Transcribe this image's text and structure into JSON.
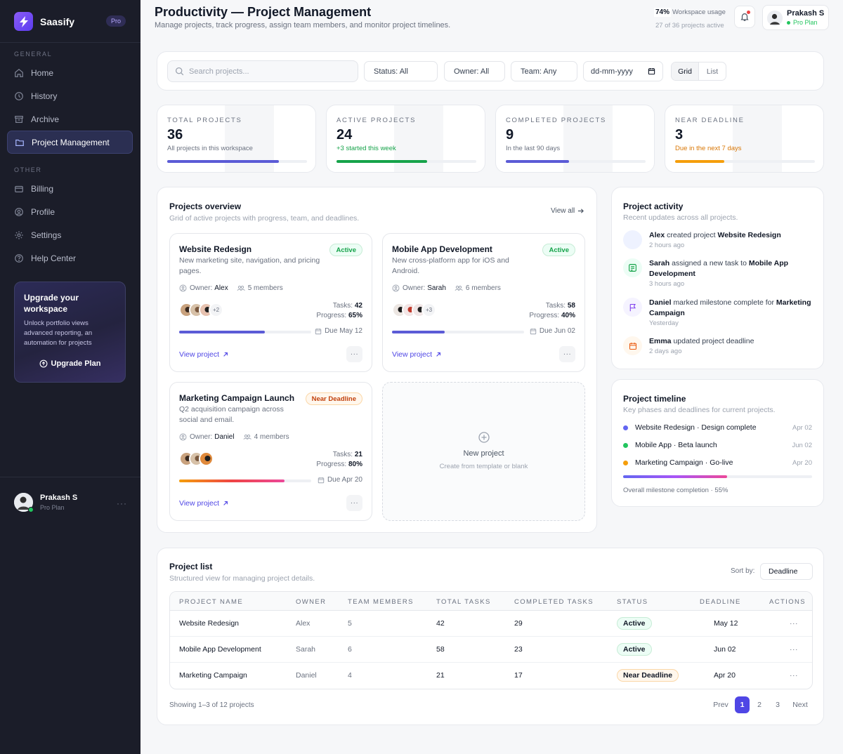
{
  "brand": {
    "name": "Saasify",
    "badge": "Pro"
  },
  "sidebar": {
    "general_label": "GENERAL",
    "other_label": "OTHER",
    "general": [
      {
        "label": "Home",
        "icon": "home-icon"
      },
      {
        "label": "History",
        "icon": "clock-icon"
      },
      {
        "label": "Archive",
        "icon": "archive-icon"
      },
      {
        "label": "Project Management",
        "icon": "folder-icon",
        "active": true
      }
    ],
    "other": [
      {
        "label": "Billing",
        "icon": "card-icon"
      },
      {
        "label": "Profile",
        "icon": "user-icon"
      },
      {
        "label": "Settings",
        "icon": "gear-icon"
      },
      {
        "label": "Help Center",
        "icon": "help-icon"
      }
    ],
    "upgrade": {
      "title": "Upgrade your workspace",
      "text": "Unlock portfolio views advanced reporting, an automation for projects",
      "button": "Upgrade Plan"
    },
    "user": {
      "name": "Prakash S",
      "plan": "Pro Plan"
    }
  },
  "header": {
    "title": "Productivity — Project Management",
    "subtitle": "Manage projects, track progress, assign team members, and monitor project timelines.",
    "usage_pct": "74%",
    "usage_label": "Workspace usage",
    "usage_sub": "27 of 36 projects active",
    "user_name": "Prakash S",
    "user_plan": "Pro Plan"
  },
  "filters": {
    "search_placeholder": "Search projects...",
    "status": "Status: All",
    "owner": "Owner: All",
    "team": "Team: Any",
    "date": "dd-mm-yyyy",
    "view_grid": "Grid",
    "view_list": "List"
  },
  "stats": [
    {
      "label": "TOTAL PROJECTS",
      "value": "36",
      "note": "All projects in this workspace",
      "progress": 0.8,
      "color": "#5b5bd6",
      "note_color": "#6b7280"
    },
    {
      "label": "ACTIVE PROJECTS",
      "value": "24",
      "note": "+3 started this week",
      "progress": 0.65,
      "color": "#16a34a",
      "note_color": "#16a34a"
    },
    {
      "label": "COMPLETED PROJECTS",
      "value": "9",
      "note": "In the last 90 days",
      "progress": 0.45,
      "color": "#5b5bd6",
      "note_color": "#6b7280"
    },
    {
      "label": "NEAR DEADLINE",
      "value": "3",
      "note": "Due in the next 7 days",
      "progress": 0.35,
      "color": "#f59e0b",
      "note_color": "#d97706"
    }
  ],
  "overview": {
    "title": "Projects overview",
    "subtitle": "Grid of active projects with progress, team, and deadlines.",
    "view_all": "View all",
    "projects": [
      {
        "title": "Website Redesign",
        "desc": "New marketing site, navigation, and pricing pages.",
        "status": "Active",
        "owner_label": "Owner:",
        "owner": "Alex",
        "members": "5 members",
        "more": "+2",
        "tasks_label": "Tasks:",
        "tasks": "42",
        "progress_label": "Progress:",
        "progress_text": "65%",
        "progress": 0.65,
        "due": "Due May 12",
        "link": "View project",
        "bar_color": "#5b5bd6"
      },
      {
        "title": "Mobile App Development",
        "desc": "New cross-platform app for iOS and Android.",
        "status": "Active",
        "owner_label": "Owner:",
        "owner": "Sarah",
        "members": "6 members",
        "more": "+3",
        "tasks_label": "Tasks:",
        "tasks": "58",
        "progress_label": "Progress:",
        "progress_text": "40%",
        "progress": 0.4,
        "due": "Due Jun 02",
        "link": "View project",
        "bar_color": "#5b5bd6"
      },
      {
        "title": "Marketing Campaign Launch",
        "desc": "Q2 acquisition campaign across social and email.",
        "status": "Near Deadline",
        "owner_label": "Owner:",
        "owner": "Daniel",
        "members": "4 members",
        "more": "",
        "tasks_label": "Tasks:",
        "tasks": "21",
        "progress_label": "Progress:",
        "progress_text": "80%",
        "progress": 0.8,
        "due": "Due Apr 20",
        "link": "View project",
        "bar_color": "gradient"
      }
    ],
    "new_project": {
      "title": "New project",
      "subtitle": "Create from template or blank"
    }
  },
  "activity": {
    "title": "Project activity",
    "subtitle": "Recent updates across all projects.",
    "items": [
      {
        "who": "Alex",
        "action": "created project",
        "target": "Website Redesign",
        "time": "2 hours ago",
        "icon": "blank-icon",
        "bg": "#eef2ff"
      },
      {
        "who": "Sarah",
        "action": "assigned a new task to",
        "target": "Mobile App Development",
        "time": "3 hours ago",
        "icon": "task-icon",
        "bg": "#ecfdf5"
      },
      {
        "who": "Daniel",
        "action": "marked milestone complete for",
        "target": "Marketing Campaign",
        "time": "Yesterday",
        "icon": "flag-icon",
        "bg": "#f5f3ff"
      },
      {
        "who": "Emma",
        "action": "updated project deadline",
        "target": "",
        "time": "2 days ago",
        "icon": "calendar-icon",
        "bg": "#fff7ed"
      }
    ]
  },
  "timeline": {
    "title": "Project timeline",
    "subtitle": "Key phases and deadlines for current projects.",
    "items": [
      {
        "label": "Website Redesign · Design complete",
        "date": "Apr 02",
        "color": "#6366f1"
      },
      {
        "label": "Mobile App · Beta launch",
        "date": "Jun 02",
        "color": "#22c55e"
      },
      {
        "label": "Marketing Campaign · Go-live",
        "date": "Apr 20",
        "color": "#f59e0b"
      }
    ],
    "completion": 0.55,
    "note": "Overall milestone completion · 55%"
  },
  "project_list": {
    "title": "Project list",
    "subtitle": "Structured view for managing project details.",
    "sort_label": "Sort by:",
    "sort_value": "Deadline",
    "columns": [
      "PROJECT NAME",
      "OWNER",
      "TEAM MEMBERS",
      "TOTAL TASKS",
      "COMPLETED TASKS",
      "STATUS",
      "DEADLINE",
      "ACTIONS"
    ],
    "rows": [
      {
        "name": "Website Redesign",
        "owner": "Alex",
        "members": "5",
        "total": "42",
        "completed": "29",
        "status": "Active",
        "deadline": "May 12",
        "actions": "···"
      },
      {
        "name": "Mobile App Development",
        "owner": "Sarah",
        "members": "6",
        "total": "58",
        "completed": "23",
        "status": "Active",
        "deadline": "Jun 02",
        "actions": "···"
      },
      {
        "name": "Marketing Campaign",
        "owner": "Daniel",
        "members": "4",
        "total": "21",
        "completed": "17",
        "status": "Near Deadline",
        "deadline": "Apr 20",
        "actions": "···"
      }
    ],
    "showing": "Showing 1–3 of 12 projects",
    "pagination": {
      "prev": "Prev",
      "pages": [
        "1",
        "2",
        "3"
      ],
      "current": "1",
      "next": "Next"
    }
  }
}
